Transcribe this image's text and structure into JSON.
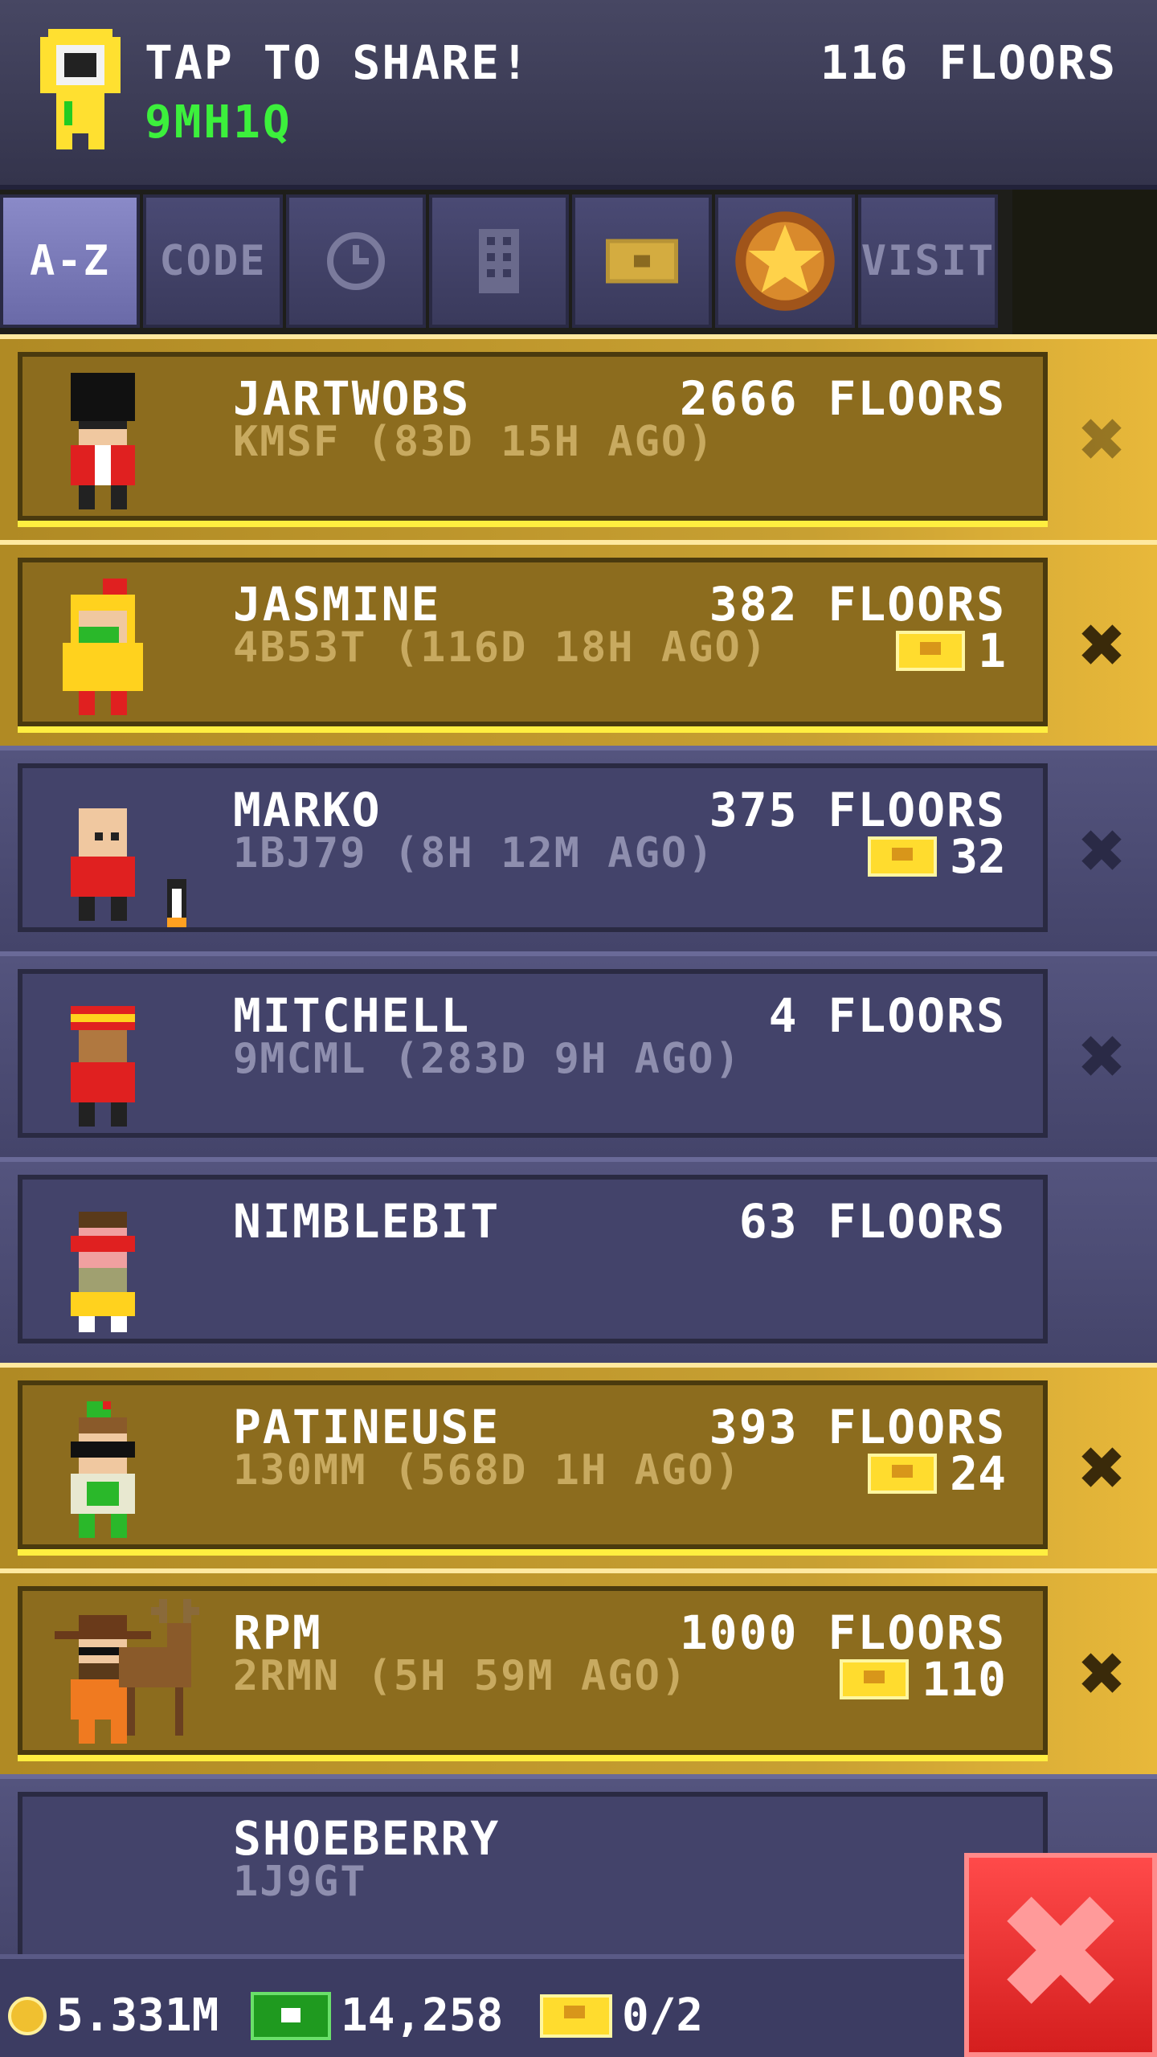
{
  "header": {
    "share_text": "TAP TO SHARE!",
    "code": "9MH1Q",
    "floors": "116 FLOORS"
  },
  "tabs": [
    {
      "label": "A-Z",
      "active": true
    },
    {
      "label": "CODE"
    },
    {
      "icon": "clock-icon"
    },
    {
      "icon": "building-icon"
    },
    {
      "icon": "ticket-icon"
    },
    {
      "icon": "star-medal-icon"
    },
    {
      "label": "VISIT"
    }
  ],
  "friends": [
    {
      "name": "JARTWOBS",
      "floors": "2666 FLOORS",
      "code": "KMSF (83D 15H AGO)",
      "tickets": "",
      "style": "gold"
    },
    {
      "name": "JASMINE",
      "floors": "382 FLOORS",
      "code": "4B53T (116D 18H AGO)",
      "tickets": "1",
      "style": "gold"
    },
    {
      "name": "MARKO",
      "floors": "375 FLOORS",
      "code": "1BJ79 (8H 12M AGO)",
      "tickets": "32",
      "style": "blue"
    },
    {
      "name": "MITCHELL",
      "floors": "4 FLOORS",
      "code": "9MCML (283D 9H AGO)",
      "tickets": "",
      "style": "blue"
    },
    {
      "name": "NIMBLEBIT",
      "floors": "63 FLOORS",
      "code": "",
      "tickets": "",
      "style": "blue"
    },
    {
      "name": "PATINEUSE",
      "floors": "393 FLOORS",
      "code": "130MM (568D 1H AGO)",
      "tickets": "24",
      "style": "gold"
    },
    {
      "name": "RPM",
      "floors": "1000 FLOORS",
      "code": "2RMN (5H 59M AGO)",
      "tickets": "110",
      "style": "gold"
    },
    {
      "name": "SHOEBERRY",
      "floors": "",
      "code": "1J9GT",
      "tickets": "",
      "style": "blue"
    }
  ],
  "footer": {
    "coins": "5.331M",
    "bux": "14,258",
    "tickets": "0/2"
  },
  "colors": {
    "gold_row": "#c8a032",
    "blue_row": "#4a4a74",
    "code_green": "#3cf03c",
    "close_red": "#e82a2a"
  }
}
